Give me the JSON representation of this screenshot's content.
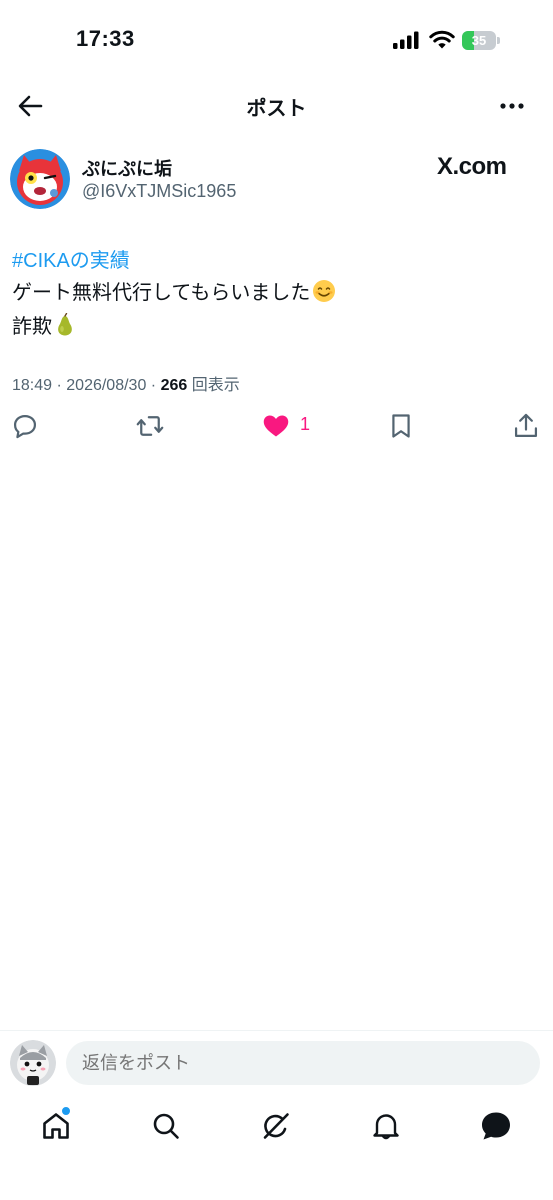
{
  "status_bar": {
    "time": "17:33",
    "battery_level": "35",
    "battery_color": "#34c759"
  },
  "header": {
    "back_icon": "arrow-left-icon",
    "title": "ポスト",
    "more_icon": "more-horizontal-icon"
  },
  "post": {
    "author_name": "ぷにぷに垢",
    "handle": "@I6VxTJMSic1965",
    "source_label": "X.com",
    "hashtag": "#CIKAの実績",
    "line1": "ゲート無料代行してもらいました",
    "line1_emoji": "smiling-face-emoji",
    "line2": "詐欺",
    "line2_emoji": "pear-emoji",
    "time": "18:49",
    "date": "2026/08/30",
    "views": "266",
    "views_label": "回表示",
    "like_count": "1",
    "liked": true,
    "like_color": "#f91880"
  },
  "actions": [
    "reply-icon",
    "repost-icon",
    "like-icon",
    "bookmark-icon",
    "share-icon"
  ],
  "reply_bar": {
    "placeholder": "返信をポスト"
  },
  "tab_bar": {
    "items": [
      "home-icon",
      "search-icon",
      "grok-icon",
      "notifications-icon",
      "messages-icon"
    ],
    "home_has_badge": true,
    "accent": "#1d9bf0"
  }
}
